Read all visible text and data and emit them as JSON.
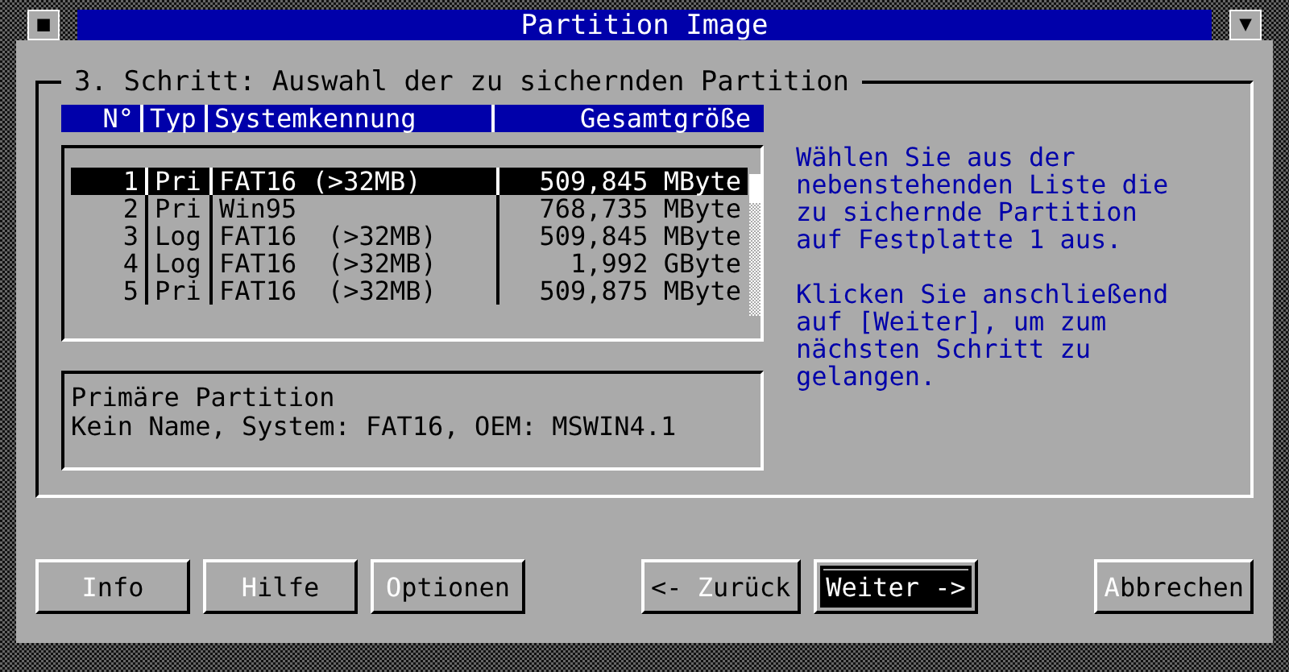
{
  "window": {
    "title": "Partition Image",
    "menu_glyph": "■",
    "dropdown_glyph": "▼"
  },
  "step": {
    "title": "3. Schritt: Auswahl der zu sichernden Partition"
  },
  "table": {
    "columns": [
      "N°",
      "Typ",
      "Systemkennung",
      "Gesamtgröße"
    ],
    "rows": [
      {
        "cells": [
          "1",
          "Pri",
          "FAT16 (>32MB)",
          "509,845 MByte"
        ],
        "selected": true
      },
      {
        "cells": [
          "2",
          "Pri",
          "Win95",
          "768,735 MByte"
        ],
        "selected": false
      },
      {
        "cells": [
          "3",
          "Log",
          "FAT16  (>32MB)",
          "509,845 MByte"
        ],
        "selected": false
      },
      {
        "cells": [
          "4",
          "Log",
          "FAT16  (>32MB)",
          "1,992 GByte"
        ],
        "selected": false
      },
      {
        "cells": [
          "5",
          "Pri",
          "FAT16  (>32MB)",
          "509,875 MByte"
        ],
        "selected": false
      }
    ]
  },
  "details": [
    "Primäre Partition",
    "Kein Name, System: FAT16, OEM: MSWIN4.1"
  ],
  "help": [
    "Wählen Sie aus der nebenstehenden Liste die zu sichernde Partition auf Festplatte 1 aus.",
    "Klicken Sie anschließend auf [Weiter], um zum nächsten Schritt zu gelangen."
  ],
  "button_groups": [
    [
      {
        "key": "I",
        "post": "nfo",
        "focused": false
      },
      {
        "key": "H",
        "post": "ilfe",
        "focused": false
      },
      {
        "key": "O",
        "post": "ptionen",
        "focused": false
      }
    ],
    [
      {
        "pre": "<- ",
        "key": "Z",
        "post": "urück",
        "focused": false
      },
      {
        "pre": "Weiter ->",
        "focused": true
      }
    ],
    [
      {
        "key": "A",
        "post": "bbrechen",
        "focused": false
      }
    ]
  ]
}
